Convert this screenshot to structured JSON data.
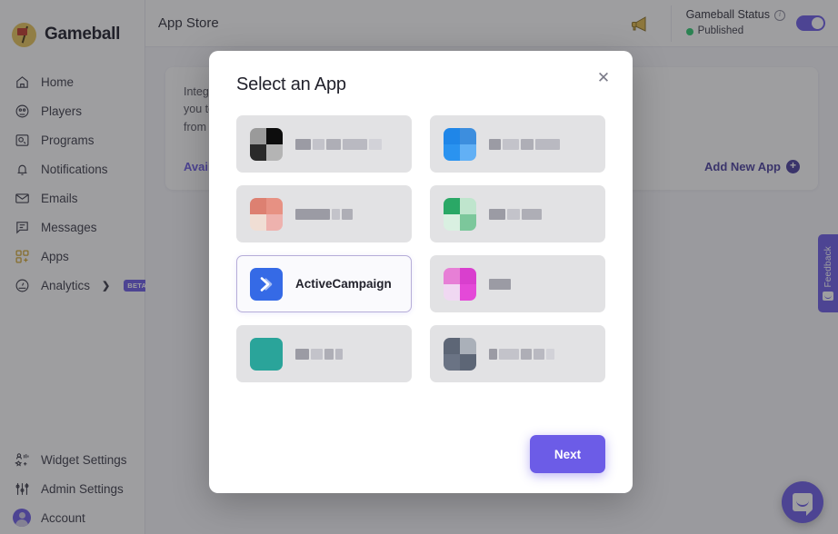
{
  "brand": {
    "name": "Gameball",
    "logo_icon": "gameball-flag-logo",
    "accent": "#6c5ce7"
  },
  "sidebar": {
    "items": [
      {
        "label": "Home",
        "icon": "home-icon"
      },
      {
        "label": "Players",
        "icon": "players-mushroom-icon"
      },
      {
        "label": "Programs",
        "icon": "programs-icon"
      },
      {
        "label": "Notifications",
        "icon": "bell-icon"
      },
      {
        "label": "Emails",
        "icon": "envelope-icon"
      },
      {
        "label": "Messages",
        "icon": "message-icon"
      },
      {
        "label": "Apps",
        "icon": "apps-grid-icon"
      },
      {
        "label": "Analytics",
        "icon": "analytics-gauge-icon",
        "chevron": "❯",
        "badge": "BETA"
      }
    ],
    "bottom_items": [
      {
        "label": "Widget Settings",
        "icon": "widget-settings-icon"
      },
      {
        "label": "Admin Settings",
        "icon": "admin-settings-sliders-icon"
      },
      {
        "label": "Account",
        "icon": "account-avatar-icon"
      }
    ]
  },
  "header": {
    "title": "App Store",
    "megaphone_icon": "megaphone-icon",
    "status_label": "Gameball Status",
    "info_icon": "info-icon",
    "status_value": "Published",
    "status_color": "#2ecc71",
    "toggle_state": "on"
  },
  "page": {
    "blurb_lines": [
      "Integrate Gameball with the other apps you use. Gameball's apps allow",
      "you to push Gameball data to other apps, and/or pull in data",
      "from other apps into Gameball."
    ],
    "available_link": "Available Apps",
    "add_new_app": "Add New App",
    "add_new_app_icon": "plus-circle-icon"
  },
  "modal": {
    "title": "Select an App",
    "close_icon": "close-icon",
    "next_label": "Next",
    "apps": [
      {
        "name": "",
        "redacted": true,
        "logo_colors": [
          "#9a9a9a",
          "#0d0d0d",
          "#2a2a2a",
          "#b4b4b4"
        ],
        "name_bar_widths": [
          17,
          13,
          16,
          27,
          14
        ],
        "selected": false
      },
      {
        "name": "",
        "redacted": true,
        "logo_colors": [
          "#1f86e8",
          "#3d8ede",
          "#2a93f0",
          "#62b0f5"
        ],
        "name_bar_widths": [
          13,
          18,
          14,
          27
        ],
        "selected": false
      },
      {
        "name": "",
        "redacted": true,
        "logo_colors": [
          "#dd8071",
          "#e79183",
          "#f0ded4",
          "#eeb2ae"
        ],
        "name_bar_widths": [
          38,
          9,
          12
        ],
        "selected": false
      },
      {
        "name": "",
        "redacted": true,
        "logo_colors": [
          "#2aa866",
          "#bfe5cd",
          "#d9f0e1",
          "#7cc79b"
        ],
        "name_bar_widths": [
          18,
          14,
          22
        ],
        "selected": false
      },
      {
        "name": "ActiveCampaign",
        "redacted": false,
        "logo_colors": [
          "#356ae6"
        ],
        "logo_icon": "activecampaign-chevron-icon",
        "selected": true
      },
      {
        "name": "",
        "redacted": true,
        "logo_colors": [
          "#e77fd6",
          "#d93fce",
          "#f0d8f2",
          "#e449d8"
        ],
        "name_bar_widths": [
          24
        ],
        "selected": false
      },
      {
        "name": "",
        "redacted": true,
        "logo_colors": [
          "#2aa49a"
        ],
        "name_bar_widths": [
          15,
          13,
          10,
          8
        ],
        "selected": false
      },
      {
        "name": "",
        "redacted": true,
        "logo_colors": [
          "#5d6676",
          "#aab0b9",
          "#6a7384"
        ],
        "name_bar_widths": [
          9,
          22,
          12,
          12,
          9
        ],
        "selected": false
      }
    ]
  },
  "feedback": {
    "label": "Feedback",
    "icon": "feedback-face-icon"
  },
  "intercom": {
    "icon": "intercom-chat-icon"
  }
}
